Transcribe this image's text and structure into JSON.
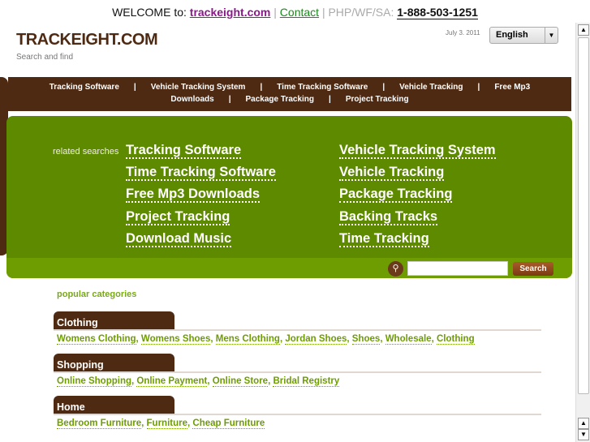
{
  "topbar": {
    "welcome": "WELCOME to:",
    "site": "trackeight.com",
    "sep": "|",
    "contact": "Contact",
    "label": "PHP/WF/SA:",
    "phone": "1-888-503-1251"
  },
  "header": {
    "title": "TRACKEIGHT.COM",
    "tagline": "Search and find",
    "date": "July 3. 2011",
    "language": "English"
  },
  "nav": [
    "Tracking Software",
    "Vehicle Tracking System",
    "Time Tracking Software",
    "Vehicle Tracking",
    "Free Mp3 Downloads",
    "Package Tracking",
    "Project Tracking"
  ],
  "nav_sep": "|",
  "related": {
    "label": "related searches",
    "left": [
      "Tracking Software",
      "Time Tracking Software",
      "Free Mp3 Downloads",
      "Project Tracking",
      "Download Music"
    ],
    "right": [
      "Vehicle Tracking System",
      "Vehicle Tracking",
      "Package Tracking",
      "Backing Tracks",
      "Time Tracking"
    ]
  },
  "search": {
    "value": "",
    "button": "Search"
  },
  "popular": {
    "title": "popular categories",
    "categories": [
      {
        "name": "Clothing",
        "links": [
          "Womens Clothing",
          "Womens Shoes",
          "Mens Clothing",
          "Jordan Shoes",
          "Shoes",
          "Wholesale",
          "Clothing"
        ]
      },
      {
        "name": "Shopping",
        "links": [
          "Online Shopping",
          "Online Payment",
          "Online Store",
          "Bridal Registry"
        ]
      },
      {
        "name": "Home",
        "links": [
          "Bedroom Furniture",
          "Furniture",
          "Cheap Furniture"
        ]
      }
    ]
  }
}
